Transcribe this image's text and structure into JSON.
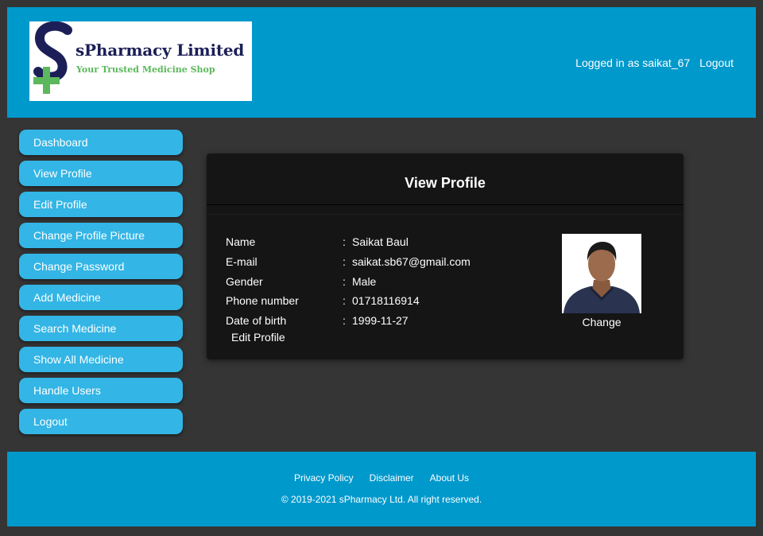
{
  "brand": {
    "name": "sPharmacy Limited",
    "tagline": "Your Trusted Medicine Shop"
  },
  "header": {
    "logged_in_text": "Logged in as saikat_67",
    "logout_label": "Logout"
  },
  "sidebar": {
    "items": [
      {
        "label": "Dashboard"
      },
      {
        "label": "View Profile"
      },
      {
        "label": "Edit Profile"
      },
      {
        "label": "Change Profile Picture"
      },
      {
        "label": "Change Password"
      },
      {
        "label": "Add Medicine"
      },
      {
        "label": "Search Medicine"
      },
      {
        "label": "Show All Medicine"
      },
      {
        "label": "Handle Users"
      },
      {
        "label": "Logout"
      }
    ]
  },
  "profile": {
    "title": "View Profile",
    "separator": ":",
    "fields": [
      {
        "label": "Name",
        "value": "Saikat Baul"
      },
      {
        "label": "E-mail",
        "value": "saikat.sb67@gmail.com"
      },
      {
        "label": "Gender",
        "value": "Male"
      },
      {
        "label": "Phone number",
        "value": "01718116914"
      },
      {
        "label": "Date of birth",
        "value": "1999-11-27"
      }
    ],
    "edit_label": "Edit Profile",
    "change_label": "Change"
  },
  "footer": {
    "links": [
      "Privacy Policy",
      "Disclaimer",
      "About Us"
    ],
    "copyright": "© 2019-2021 sPharmacy Ltd. All right reserved."
  },
  "colors": {
    "header_bg": "#0099cc",
    "nav_button": "#33b5e5",
    "page_bg": "#353535",
    "card_bg": "#151515",
    "brand_navy": "#1c1f57",
    "brand_green": "#5cb85c"
  }
}
